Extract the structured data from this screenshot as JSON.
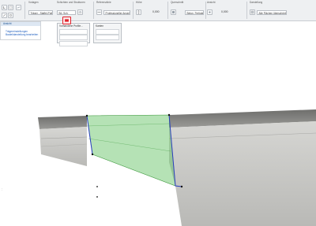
{
  "toolbar": {
    "groups": [
      {
        "label": "Vorlagen"
      },
      {
        "label": "Schichten und Strukturen"
      },
      {
        "label": "Referenzlinie"
      },
      {
        "label": "Höhe"
      },
      {
        "label": "Querschnitt"
      },
      {
        "label": "Ansicht"
      },
      {
        "label": "Darstellung"
      }
    ],
    "preset_dropdown": "Träger - Staffel-Pult...",
    "structure_dropdown": "Bö. Sch.",
    "profile_dropdown": "Professioneller Ansichtsstil...",
    "material_dropdown": "Beton, Fertigteil...",
    "elevation_value": "0,000",
    "offset_value": "0,000",
    "override_dropdown": "Alle Flächen überschrieben"
  },
  "left_panel": {
    "title": "Ansicht",
    "links": [
      "Trägereinstellungen",
      "Bauteildarstellung bearbeiten"
    ]
  },
  "popup_profiles": {
    "title": "Vorhandene Profile..."
  },
  "popup_edges": {
    "title": "Kanten"
  },
  "scene": {
    "beam_color": "#c9c9c7",
    "selection_fill": "#5cbf5c",
    "selection_edge": "#2a3fbf",
    "accent": "#e0202a"
  }
}
